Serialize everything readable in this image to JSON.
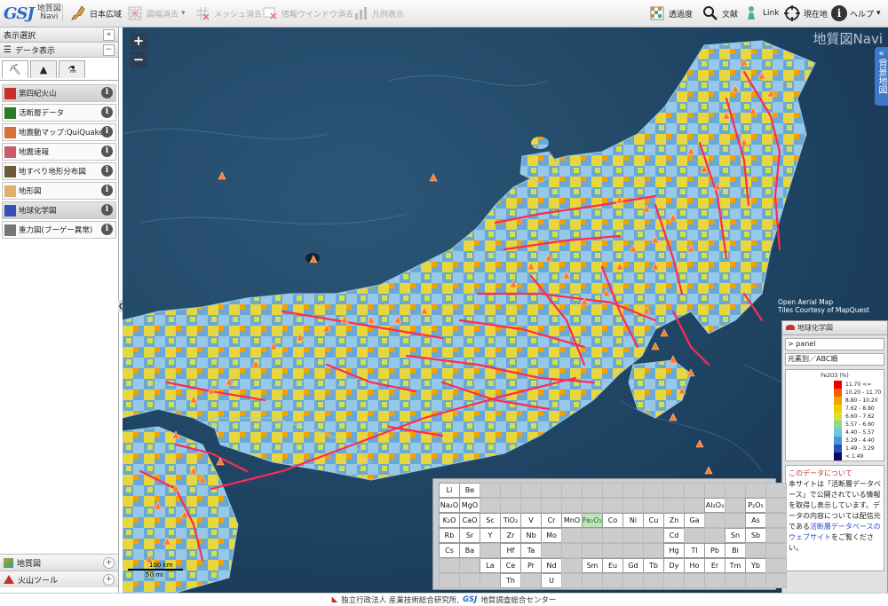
{
  "app": {
    "logo_mark": "GSJ",
    "logo_line1": "地質図",
    "logo_line2": "Navi",
    "map_brand": "地質図Navi"
  },
  "toolbar": {
    "japan_wide": "日本広域",
    "clear_outlines": "図幅消去",
    "clear_mesh": "メッシュ消去",
    "clear_info_window": "情報ウインドウ消去",
    "show_legend": "凡例表示",
    "transparency": "透過度",
    "literature": "文献",
    "link": "Link",
    "current_location": "現在地",
    "help": "ヘルプ"
  },
  "sidebar": {
    "title": "表示選択",
    "collapse": "«",
    "data_display": "データ表示",
    "data_toggle": "−",
    "layers": [
      {
        "label": "第四紀火山",
        "icon_color": "#c8312b",
        "active": true
      },
      {
        "label": "活断層データ",
        "icon_color": "#2a7a2a",
        "active": false
      },
      {
        "label": "地震動マップ:QuiQuake",
        "icon_color": "#d9723a",
        "active": false
      },
      {
        "label": "地震速報",
        "icon_color": "#c85c6a",
        "active": false
      },
      {
        "label": "地すべり地形分布図",
        "icon_color": "#6b5b3a",
        "active": false
      },
      {
        "label": "地形図",
        "icon_color": "#e0b070",
        "active": false
      },
      {
        "label": "地球化学図",
        "icon_color": "#3a4fb0",
        "active": true
      },
      {
        "label": "重力図(ブーゲー異常)",
        "icon_color": "#777777",
        "active": false
      }
    ],
    "bottom": [
      {
        "label": "地質図"
      },
      {
        "label": "火山ツール"
      }
    ],
    "info_symbol": "i",
    "plus_symbol": "+"
  },
  "map": {
    "zoom_in": "+",
    "zoom_out": "−",
    "bgmap_tab": "背景地図",
    "attribution_line1": "Open Aerial Map",
    "attribution_line2": "Tiles Courtesy of MapQuest",
    "scale_km": "100 km",
    "scale_mi": "50 mi"
  },
  "legend": {
    "title": "地球化学図",
    "panel_button": "> panel",
    "sub_button": "元素別／ABC順",
    "ramp_title": "Fe2O3 (%)",
    "ramp": [
      {
        "label": "11.70 <=",
        "color": "#e80000"
      },
      {
        "label": "10.20 - 11.70",
        "color": "#f06000"
      },
      {
        "label": "8.80 - 10.20",
        "color": "#f4a000"
      },
      {
        "label": "7.62 - 8.80",
        "color": "#f0cc00"
      },
      {
        "label": "6.60 - 7.62",
        "color": "#d8e040"
      },
      {
        "label": "5.57 - 6.60",
        "color": "#8fd890"
      },
      {
        "label": "4.40 - 5.57",
        "color": "#6cc8e0"
      },
      {
        "label": "3.29 - 4.40",
        "color": "#4a9ad8"
      },
      {
        "label": "1.49 - 3.29",
        "color": "#2a50b8"
      },
      {
        "label": "< 1.49",
        "color": "#0a0a6a"
      }
    ],
    "notice_title": "このデータについて",
    "notice_body1": "本サイトは「活断層データベース」で公開されている情報を取得し表示しています。データの内容については配信元である",
    "notice_link": "活断層データベースのウェブサイト",
    "notice_body2": "をご覧ください。"
  },
  "periodic": {
    "selected": "Fe₂O₃",
    "rows": [
      [
        "Li",
        "Be",
        "",
        "",
        "",
        "",
        "",
        "",
        "",
        "",
        "",
        "",
        "",
        "",
        "",
        "",
        ""
      ],
      [
        "Na₂O",
        "MgO",
        "",
        "",
        "",
        "",
        "",
        "",
        "",
        "",
        "",
        "",
        "",
        "Al₂O₃",
        "",
        "P₂O₅",
        ""
      ],
      [
        "K₂O",
        "CaO",
        "Sc",
        "TiO₂",
        "V",
        "Cr",
        "MnO",
        "Fe₂O₃",
        "Co",
        "Ni",
        "Cu",
        "Zn",
        "Ga",
        "",
        "",
        "As",
        ""
      ],
      [
        "Rb",
        "Sr",
        "Y",
        "Zr",
        "Nb",
        "Mo",
        "",
        "",
        "",
        "",
        "",
        "Cd",
        "",
        "",
        "Sn",
        "Sb",
        ""
      ],
      [
        "Cs",
        "Ba",
        "",
        "Hf",
        "Ta",
        "",
        "",
        "",
        "",
        "",
        "",
        "Hg",
        "Tl",
        "Pb",
        "Bi",
        "",
        ""
      ],
      [
        "",
        "",
        "La",
        "Ce",
        "Pr",
        "Nd",
        "",
        "Sm",
        "Eu",
        "Gd",
        "Tb",
        "Dy",
        "Ho",
        "Er",
        "Tm",
        "Yb",
        ""
      ],
      [
        "",
        "",
        "",
        "Th",
        "",
        "U",
        "",
        "",
        "",
        "",
        "",
        "",
        "",
        "",
        "",
        "",
        ""
      ]
    ]
  },
  "footer": {
    "aist": "独立行政法人 産業技術総合研究所,",
    "gsj": "地質調査総合センター"
  },
  "colors": {
    "accent": "#2e66c4",
    "fault": "#ff2a55",
    "volcano": "#ff7a2a"
  }
}
